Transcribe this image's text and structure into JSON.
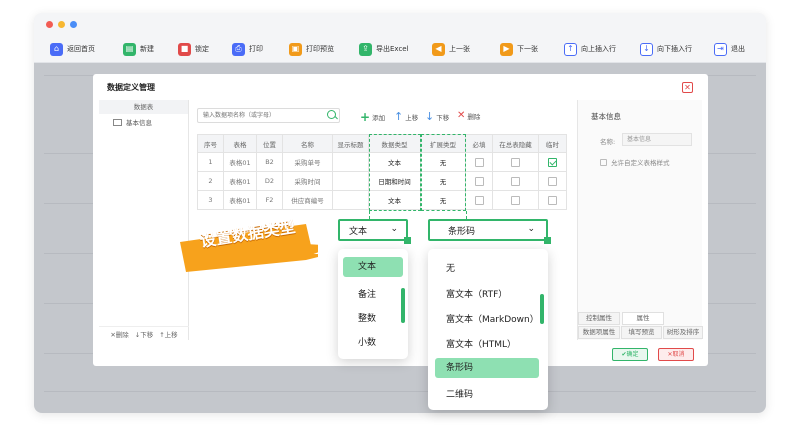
{
  "toolbar": {
    "items": [
      {
        "label": "返回首页",
        "icon": "home-icon",
        "color": "#4a6cf7"
      },
      {
        "label": "新建",
        "icon": "new-doc-icon",
        "color": "#32b56a"
      },
      {
        "label": "锁定",
        "icon": "lock-icon",
        "color": "#e14a4a"
      },
      {
        "label": "打印",
        "icon": "print-icon",
        "color": "#4a6cf7"
      },
      {
        "label": "打印预览",
        "icon": "print-preview-icon",
        "color": "#f19a1a"
      },
      {
        "label": "导出Excel",
        "icon": "excel-icon",
        "color": "#32b56a"
      },
      {
        "label": "上一张",
        "icon": "prev-icon",
        "color": "#f19a1a"
      },
      {
        "label": "下一张",
        "icon": "next-icon",
        "color": "#f19a1a"
      },
      {
        "label": "向上插入行",
        "icon": "insert-up-icon",
        "color": "#4a6cf7"
      },
      {
        "label": "向下插入行",
        "icon": "insert-down-icon",
        "color": "#4a6cf7"
      },
      {
        "label": "退出",
        "icon": "exit-icon",
        "color": "#4a6cf7"
      }
    ]
  },
  "dialog": {
    "title": "数据定义管理",
    "left": {
      "header": "数据表",
      "item": "基本信息",
      "footer_delete": "✕删除",
      "footer_down": "↓下移",
      "footer_up": "↑上移"
    },
    "search_placeholder": "输入数据项名称（或字母）",
    "actions": {
      "add": "添加",
      "up": "上移",
      "down": "下移",
      "delete": "删除"
    },
    "table": {
      "headers": [
        "序号",
        "表格",
        "位置",
        "名称",
        "显示标题",
        "数据类型",
        "扩展类型",
        "必填",
        "在总表隐藏",
        "临时"
      ],
      "rows": [
        {
          "no": "1",
          "table": "表格01",
          "pos": "B2",
          "name": "采购单号",
          "title": "",
          "type": "文本",
          "ext": "无",
          "temp": true
        },
        {
          "no": "2",
          "table": "表格01",
          "pos": "D2",
          "name": "采购时间",
          "title": "",
          "type": "日期和时间",
          "ext": "无",
          "temp": false
        },
        {
          "no": "3",
          "table": "表格01",
          "pos": "F2",
          "name": "供应商编号",
          "title": "",
          "type": "文本",
          "ext": "无",
          "temp": false
        }
      ]
    },
    "right": {
      "title": "基本信息",
      "name_label": "名称:",
      "name_value": "基本信息",
      "checkbox_label": "允许自定义表格样式",
      "tabs_row1": [
        "控制属性",
        "属性"
      ],
      "tabs_row2": [
        "数据项属性",
        "填写预览",
        "树形及排序"
      ]
    },
    "ok_label": "✔确定",
    "cancel_label": "✕取消"
  },
  "overlay": {
    "type_select": "文本",
    "type_options": [
      "文本",
      "备注",
      "整数",
      "小数"
    ],
    "ext_select": "条形码",
    "ext_options": [
      "无",
      "富文本（RTF）",
      "富文本（MarkDown）",
      "富文本（HTML）",
      "条形码",
      "二维码"
    ],
    "callout": "设置数据类型"
  },
  "colors": {
    "accent": "#32b56a",
    "callout": "#f7a21c"
  }
}
